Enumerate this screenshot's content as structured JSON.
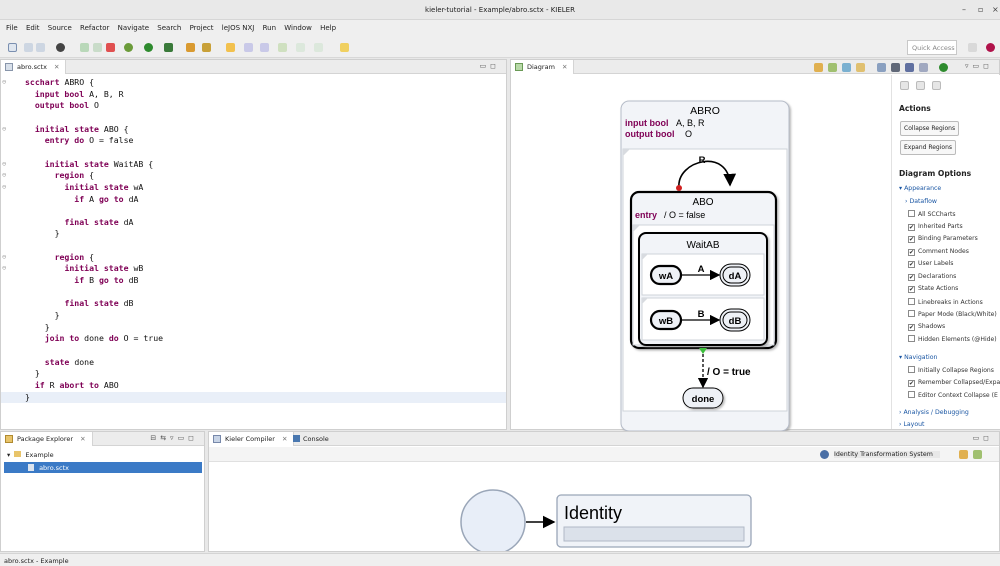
{
  "window": {
    "title": "kieler-tutorial - Example/abro.sctx - KIELER",
    "minimize": "–",
    "maximize": "▫",
    "close": "×"
  },
  "menu": [
    "File",
    "Edit",
    "Source",
    "Refactor",
    "Navigate",
    "Search",
    "Project",
    "leJOS NXJ",
    "Run",
    "Window",
    "Help"
  ],
  "toolbar": {
    "quick_access": "Quick Access"
  },
  "editor": {
    "tab": "abro.sctx",
    "lines": [
      {
        "m": "⊖",
        "t": [
          [
            "kw",
            "scchart"
          ],
          [
            "",
            "ABRO {"
          ]
        ]
      },
      {
        "m": "",
        "t": [
          [
            "",
            "  "
          ],
          [
            "kw",
            "input bool"
          ],
          [
            "",
            "A, B, R"
          ]
        ]
      },
      {
        "m": "",
        "t": [
          [
            "",
            "  "
          ],
          [
            "kw",
            "output bool"
          ],
          [
            "",
            "O"
          ]
        ]
      },
      {
        "m": "",
        "t": [
          [
            "",
            ""
          ]
        ]
      },
      {
        "m": "⊖",
        "t": [
          [
            "",
            "  "
          ],
          [
            "kw",
            "initial state"
          ],
          [
            "",
            "ABO {"
          ]
        ]
      },
      {
        "m": "",
        "t": [
          [
            "",
            "    "
          ],
          [
            "kw",
            "entry do"
          ],
          [
            "",
            "O = false"
          ]
        ]
      },
      {
        "m": "",
        "t": [
          [
            "",
            ""
          ]
        ]
      },
      {
        "m": "⊖",
        "t": [
          [
            "",
            "    "
          ],
          [
            "kw",
            "initial state"
          ],
          [
            "",
            "WaitAB {"
          ]
        ]
      },
      {
        "m": "⊖",
        "t": [
          [
            "",
            "      "
          ],
          [
            "kw",
            "region"
          ],
          [
            "",
            "{"
          ]
        ]
      },
      {
        "m": "⊖",
        "t": [
          [
            "",
            "        "
          ],
          [
            "kw",
            "initial state"
          ],
          [
            "",
            "wA"
          ]
        ]
      },
      {
        "m": "",
        "t": [
          [
            "",
            "          "
          ],
          [
            "kw",
            "if"
          ],
          [
            "",
            "A"
          ],
          [
            "kw",
            "go to"
          ],
          [
            "",
            "dA"
          ]
        ]
      },
      {
        "m": "",
        "t": [
          [
            "",
            ""
          ]
        ]
      },
      {
        "m": "",
        "t": [
          [
            "",
            "        "
          ],
          [
            "kw",
            "final state"
          ],
          [
            "",
            "dA"
          ]
        ]
      },
      {
        "m": "",
        "t": [
          [
            "",
            "      }"
          ]
        ]
      },
      {
        "m": "",
        "t": [
          [
            "",
            ""
          ]
        ]
      },
      {
        "m": "⊖",
        "t": [
          [
            "",
            "      "
          ],
          [
            "kw",
            "region"
          ],
          [
            "",
            "{"
          ]
        ]
      },
      {
        "m": "⊖",
        "t": [
          [
            "",
            "        "
          ],
          [
            "kw",
            "initial state"
          ],
          [
            "",
            "wB"
          ]
        ]
      },
      {
        "m": "",
        "t": [
          [
            "",
            "          "
          ],
          [
            "kw",
            "if"
          ],
          [
            "",
            "B"
          ],
          [
            "kw",
            "go to"
          ],
          [
            "",
            "dB"
          ]
        ]
      },
      {
        "m": "",
        "t": [
          [
            "",
            ""
          ]
        ]
      },
      {
        "m": "",
        "t": [
          [
            "",
            "        "
          ],
          [
            "kw",
            "final state"
          ],
          [
            "",
            "dB"
          ]
        ]
      },
      {
        "m": "",
        "t": [
          [
            "",
            "      }"
          ]
        ]
      },
      {
        "m": "",
        "t": [
          [
            "",
            "    }"
          ]
        ]
      },
      {
        "m": "",
        "t": [
          [
            "",
            "    "
          ],
          [
            "kw",
            "join to"
          ],
          [
            "",
            "done"
          ],
          [
            "kw",
            "do"
          ],
          [
            "",
            "O = true"
          ]
        ]
      },
      {
        "m": "",
        "t": [
          [
            "",
            ""
          ]
        ]
      },
      {
        "m": "",
        "t": [
          [
            "",
            "    "
          ],
          [
            "kw",
            "state"
          ],
          [
            "",
            "done"
          ]
        ]
      },
      {
        "m": "",
        "t": [
          [
            "",
            "  }"
          ]
        ]
      },
      {
        "m": "",
        "t": [
          [
            "",
            "  "
          ],
          [
            "kw",
            "if"
          ],
          [
            "",
            "R"
          ],
          [
            "kw",
            "abort to"
          ],
          [
            "",
            "ABO"
          ]
        ]
      },
      {
        "m": "",
        "t": [
          [
            "",
            "}"
          ]
        ]
      }
    ]
  },
  "diagram": {
    "tab": "Diagram",
    "root_name": "ABRO",
    "decl_input_kw": "input bool",
    "decl_input": "A, B, R",
    "decl_output_kw": "output bool",
    "decl_output": "O",
    "abort_label": "R",
    "abo_name": "ABO",
    "abo_entry_kw": "entry",
    "abo_entry": "/ O = false",
    "waitab_name": "WaitAB",
    "wa": "wA",
    "da": "dA",
    "a_label": "A",
    "wb": "wB",
    "db": "dB",
    "b_label": "B",
    "join_label": "/ O = true",
    "done": "done"
  },
  "sidebar": {
    "actions_title": "Actions",
    "collapse": "Collapse Regions",
    "expand": "Expand Regions",
    "options_title": "Diagram Options",
    "appearance": "▾ Appearance",
    "dataflow": "› Dataflow",
    "options": [
      {
        "label": "All SCCharts",
        "checked": false
      },
      {
        "label": "Inherited Parts",
        "checked": true
      },
      {
        "label": "Binding Parameters",
        "checked": true
      },
      {
        "label": "Comment Nodes",
        "checked": true
      },
      {
        "label": "User Labels",
        "checked": true
      },
      {
        "label": "Declarations",
        "checked": true
      },
      {
        "label": "State Actions",
        "checked": true
      },
      {
        "label": "Linebreaks in Actions",
        "checked": false
      },
      {
        "label": "Paper Mode (Black/White)",
        "checked": false
      },
      {
        "label": "Shadows",
        "checked": true
      },
      {
        "label": "Hidden Elements (@Hide)",
        "checked": false
      }
    ],
    "navigation": "▾ Navigation",
    "nav_options": [
      {
        "label": "Initially Collapse Regions",
        "checked": false
      },
      {
        "label": "Remember Collapsed/Expa",
        "checked": true
      },
      {
        "label": "Editor Context Collapse (E",
        "checked": false
      }
    ],
    "analysis": "› Analysis / Debugging",
    "layout": "› Layout"
  },
  "package_explorer": {
    "tab": "Package Explorer",
    "project": "Example",
    "file": "abro.sctx"
  },
  "compiler": {
    "tab": "Kieler Compiler",
    "console_tab": "Console",
    "system": "Identity Transformation System",
    "node": "Identity"
  },
  "status": {
    "text": "abro.sctx - Example"
  },
  "colors": {
    "keyword": "#7f0055",
    "selection": "#3b7ac6",
    "link": "#1a56a3"
  }
}
